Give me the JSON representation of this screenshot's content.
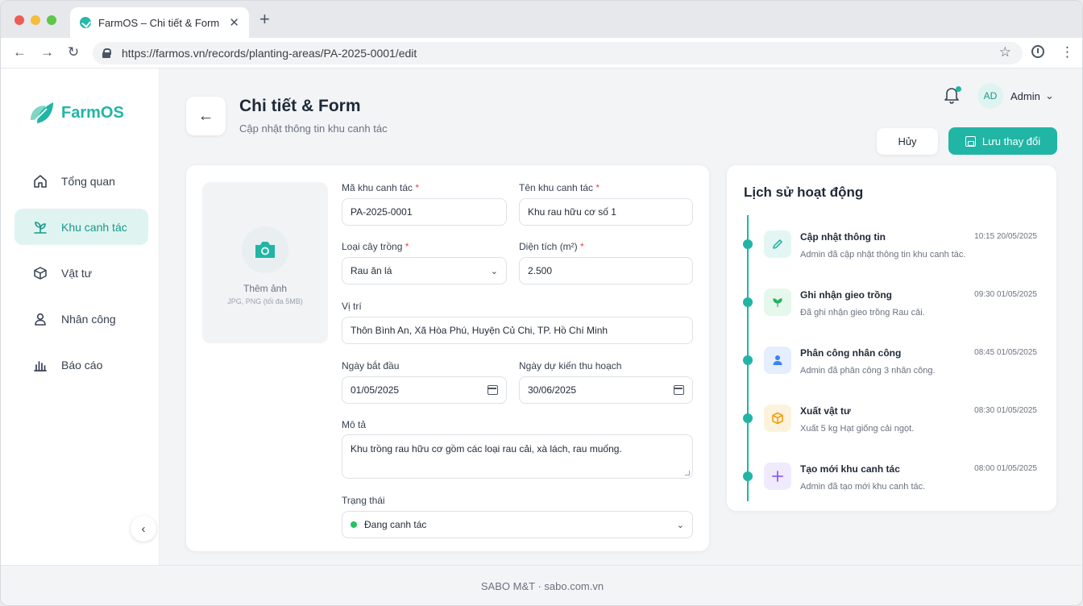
{
  "browser": {
    "tab_title": "FarmOS – Chi tiết & Form",
    "url": "https://farmos.vn/records/planting-areas/PA-2025-0001/edit"
  },
  "sidebar": {
    "brand": "FarmOS",
    "items": [
      {
        "label": "Tổng quan",
        "icon": "home-icon",
        "active": false
      },
      {
        "label": "Khu canh tác",
        "icon": "plant-icon",
        "active": true
      },
      {
        "label": "Vật tư",
        "icon": "box-icon",
        "active": false
      },
      {
        "label": "Nhân công",
        "icon": "user-icon",
        "active": false
      },
      {
        "label": "Báo cáo",
        "icon": "bar-chart-icon",
        "active": false
      }
    ]
  },
  "header": {
    "title": "Chi tiết & Form",
    "subtitle": "Cập nhật thông tin khu canh tác",
    "user_initials": "AD",
    "user_name": "Admin",
    "cancel_label": "Hủy",
    "save_label": "Lưu thay đổi"
  },
  "form": {
    "photo_label": "Thêm ảnh",
    "photo_hint": "JPG, PNG (tối đa 5MB)",
    "code_label": "Mã khu canh tác",
    "code_value": "PA-2025-0001",
    "name_label": "Tên khu canh tác",
    "name_value": "Khu rau hữu cơ số 1",
    "crop_label": "Loại cây trồng",
    "crop_value": "Rau ăn lá",
    "area_label": "Diện tích (m²)",
    "area_value": "2.500",
    "location_label": "Vị trí",
    "location_value": "Thôn Bình An, Xã Hòa Phú, Huyện Củ Chi, TP. Hồ Chí Minh",
    "start_label": "Ngày bắt đầu",
    "start_value": "01/05/2025",
    "harvest_label": "Ngày dự kiến thu hoạch",
    "harvest_value": "30/06/2025",
    "desc_label": "Mô tả",
    "desc_value": "Khu trồng rau hữu cơ gồm các loại rau cải, xà lách, rau muống.",
    "status_label": "Trạng thái",
    "status_value": "Đang canh tác",
    "required_mark": "*"
  },
  "activity": {
    "title": "Lịch sử hoạt động",
    "items": [
      {
        "title": "Cập nhật thông tin",
        "time": "10:15 20/05/2025",
        "desc": "Admin đã cập nhật thông tin khu canh tác.",
        "icon": "pencil-icon",
        "bg": "#e3f6f3",
        "fg": "#21b5a5"
      },
      {
        "title": "Ghi nhận gieo trồng",
        "time": "09:30 01/05/2025",
        "desc": "Đã ghi nhận gieo trồng Rau cải.",
        "icon": "sprout-icon",
        "bg": "#e6f7ec",
        "fg": "#22b35e"
      },
      {
        "title": "Phân công nhân công",
        "time": "08:45 01/05/2025",
        "desc": "Admin đã phân công 3 nhân công.",
        "icon": "person-icon",
        "bg": "#e4eefc",
        "fg": "#3b82f6"
      },
      {
        "title": "Xuất vật tư",
        "time": "08:30 01/05/2025",
        "desc": "Xuất 5 kg Hạt giống cải ngọt.",
        "icon": "package-icon",
        "bg": "#fdf3dd",
        "fg": "#f59e0b"
      },
      {
        "title": "Tạo mới khu canh tác",
        "time": "08:00 01/05/2025",
        "desc": "Admin đã tạo mới khu canh tác.",
        "icon": "plus-icon",
        "bg": "#f0eafd",
        "fg": "#8b5cf6"
      }
    ]
  },
  "footer": {
    "text": "SABO M&T · sabo.com.vn"
  }
}
